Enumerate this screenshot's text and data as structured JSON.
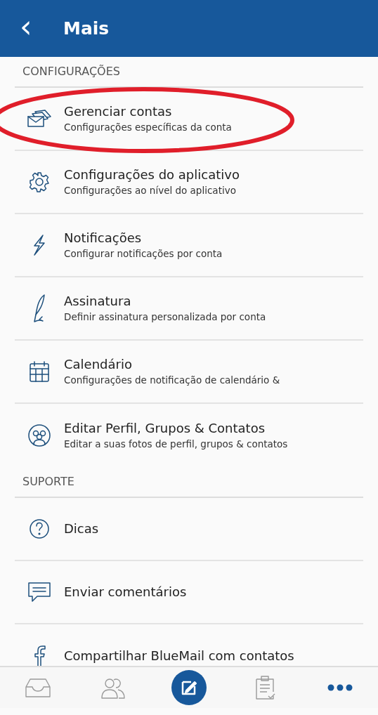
{
  "header": {
    "back": "‹",
    "title": "Mais"
  },
  "sections": [
    {
      "title": "CONFIGURAÇÕES",
      "items": [
        {
          "title": "Gerenciar contas",
          "subtitle": "Configurações específicas da conta"
        },
        {
          "title": "Configurações do aplicativo",
          "subtitle": "Configurações ao nível do aplicativo"
        },
        {
          "title": "Notificações",
          "subtitle": "Configurar notificações por conta"
        },
        {
          "title": "Assinatura",
          "subtitle": "Definir assinatura personalizada por conta"
        },
        {
          "title": "Calendário",
          "subtitle": "Configurações de notificação de calendário &"
        },
        {
          "title": "Editar Perfil, Grupos & Contatos",
          "subtitle": "Editar a suas fotos de perfil, grupos & contatos"
        }
      ]
    },
    {
      "title": "SUPORTE",
      "items": [
        {
          "title": "Dicas"
        },
        {
          "title": "Enviar comentários"
        },
        {
          "title": "Compartilhar BlueMail com contatos"
        }
      ]
    }
  ],
  "bottom_nav": [
    {
      "kind": "tab",
      "selected": false
    },
    {
      "kind": "tab",
      "selected": false
    },
    {
      "kind": "action"
    },
    {
      "kind": "tab",
      "selected": false
    },
    {
      "kind": "tab",
      "selected": true
    }
  ]
}
